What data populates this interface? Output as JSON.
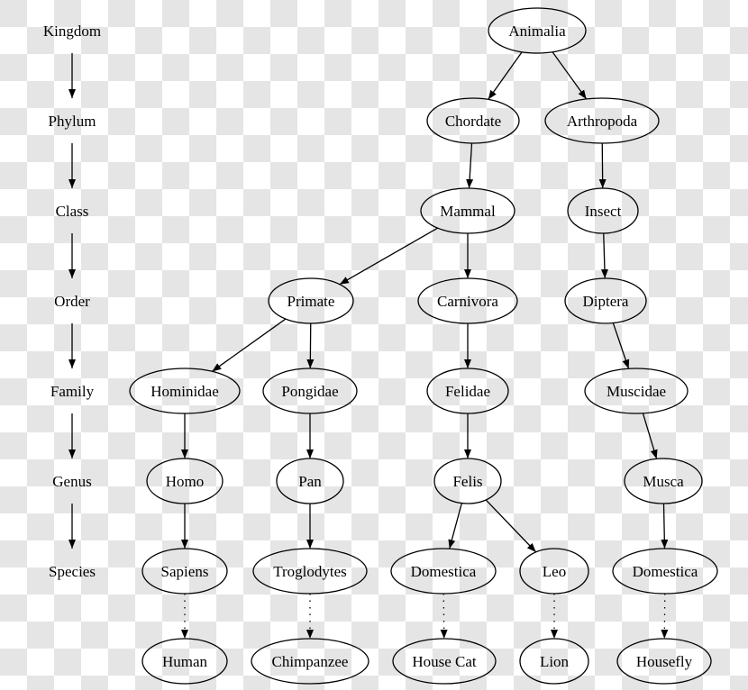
{
  "ranks": [
    "Kingdom",
    "Phylum",
    "Class",
    "Order",
    "Family",
    "Genus",
    "Species"
  ],
  "nodes": [
    {
      "id": "animalia",
      "label": "Animalia"
    },
    {
      "id": "chordate",
      "label": "Chordate"
    },
    {
      "id": "arthropoda",
      "label": "Arthropoda"
    },
    {
      "id": "mammal",
      "label": "Mammal"
    },
    {
      "id": "insect",
      "label": "Insect"
    },
    {
      "id": "primate",
      "label": "Primate"
    },
    {
      "id": "carnivora",
      "label": "Carnivora"
    },
    {
      "id": "diptera",
      "label": "Diptera"
    },
    {
      "id": "hominidae",
      "label": "Hominidae"
    },
    {
      "id": "pongidae",
      "label": "Pongidae"
    },
    {
      "id": "felidae",
      "label": "Felidae"
    },
    {
      "id": "muscidae",
      "label": "Muscidae"
    },
    {
      "id": "homo",
      "label": "Homo"
    },
    {
      "id": "pan",
      "label": "Pan"
    },
    {
      "id": "felis",
      "label": "Felis"
    },
    {
      "id": "musca",
      "label": "Musca"
    },
    {
      "id": "sapiens",
      "label": "Sapiens"
    },
    {
      "id": "troglodytes",
      "label": "Troglodytes"
    },
    {
      "id": "domestica_cat",
      "label": "Domestica"
    },
    {
      "id": "leo",
      "label": "Leo"
    },
    {
      "id": "domestica_fly",
      "label": "Domestica"
    },
    {
      "id": "human",
      "label": "Human"
    },
    {
      "id": "chimpanzee",
      "label": "Chimpanzee"
    },
    {
      "id": "housecat",
      "label": "House Cat"
    },
    {
      "id": "lion",
      "label": "Lion"
    },
    {
      "id": "housefly",
      "label": "Housefly"
    }
  ],
  "edges": [
    {
      "from": "animalia",
      "to": "chordate"
    },
    {
      "from": "animalia",
      "to": "arthropoda"
    },
    {
      "from": "chordate",
      "to": "mammal"
    },
    {
      "from": "arthropoda",
      "to": "insect"
    },
    {
      "from": "mammal",
      "to": "primate"
    },
    {
      "from": "mammal",
      "to": "carnivora"
    },
    {
      "from": "insect",
      "to": "diptera"
    },
    {
      "from": "primate",
      "to": "hominidae"
    },
    {
      "from": "primate",
      "to": "pongidae"
    },
    {
      "from": "carnivora",
      "to": "felidae"
    },
    {
      "from": "diptera",
      "to": "muscidae"
    },
    {
      "from": "hominidae",
      "to": "homo"
    },
    {
      "from": "pongidae",
      "to": "pan"
    },
    {
      "from": "felidae",
      "to": "felis"
    },
    {
      "from": "muscidae",
      "to": "musca"
    },
    {
      "from": "homo",
      "to": "sapiens"
    },
    {
      "from": "pan",
      "to": "troglodytes"
    },
    {
      "from": "felis",
      "to": "domestica_cat"
    },
    {
      "from": "felis",
      "to": "leo"
    },
    {
      "from": "musca",
      "to": "domestica_fly"
    },
    {
      "from": "sapiens",
      "to": "human",
      "style": "dotted"
    },
    {
      "from": "troglodytes",
      "to": "chimpanzee",
      "style": "dotted"
    },
    {
      "from": "domestica_cat",
      "to": "housecat",
      "style": "dotted"
    },
    {
      "from": "leo",
      "to": "lion",
      "style": "dotted"
    },
    {
      "from": "domestica_fly",
      "to": "housefly",
      "style": "dotted"
    }
  ]
}
